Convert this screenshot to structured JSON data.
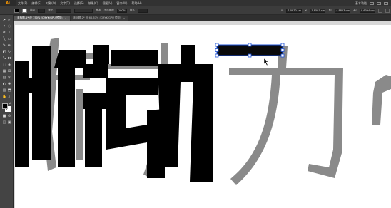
{
  "app": {
    "logo": "Ai",
    "menu": [
      "文件(F)",
      "编辑(E)",
      "对象(O)",
      "文字(T)",
      "选择(S)",
      "效果(C)",
      "视图(V)",
      "窗口(W)",
      "帮助(H)"
    ],
    "workspace": "基本功能"
  },
  "control_bar": {
    "fill_label": "填色",
    "stroke_label": "描边",
    "stroke_value": "",
    "uniform_label": "等比",
    "basic_label": "基本",
    "opacity_label": "不透明度",
    "opacity_value": "100%",
    "style_label": "样式",
    "x_label": "X:",
    "x_value": "1.0870 cm",
    "y_label": "Y:",
    "y_value": "1.8597 cm",
    "w_label": "宽:",
    "w_value": "4.8823 cm",
    "h_label": "高:",
    "h_value": "0.6094 cm"
  },
  "tabs": [
    {
      "label": "未标题-1* @ 150% (CMYK/GPU 预览)",
      "active": true
    },
    {
      "label": "未标题-2* @ 66.67% (CMYK/GPU 预览)",
      "active": false
    }
  ],
  "artwork": {
    "black_text": "励动",
    "gray_text": "励动力"
  },
  "colors": {
    "fill": "#000000",
    "stroke": "#ffffff",
    "selection": "#1a4fd6",
    "gray_glyph": "#8a8a8a"
  }
}
